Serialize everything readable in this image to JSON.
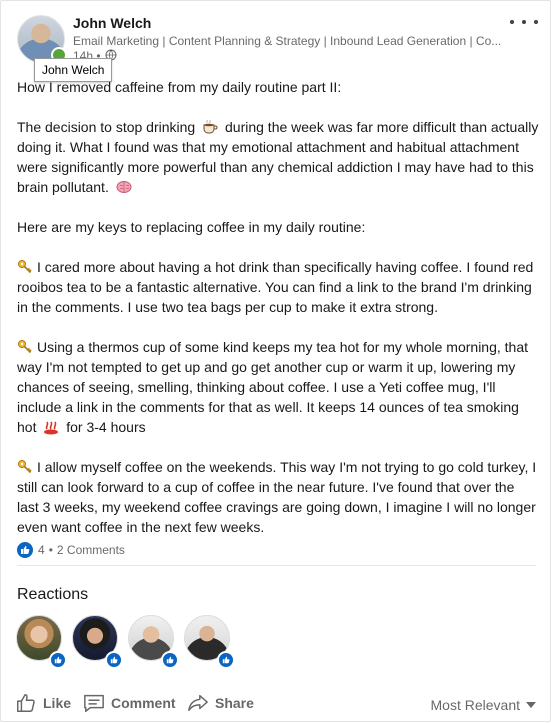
{
  "post": {
    "author_name": "John Welch",
    "author_headline": "Email Marketing | Content Planning & Strategy | Inbound Lead Generation | Co...",
    "timestamp": "14h •",
    "tooltip": "John Welch",
    "paragraphs": {
      "p1": "How I removed caffeine from my daily routine part II:",
      "p2a": "The decision to stop drinking",
      "p2b": "during the week was far more difficult than actually doing it. What I found was that my emotional attachment and habitual attachment were significantly more powerful than any chemical addiction I may have had to this brain pollutant.",
      "p3": "Here are my keys to replacing coffee in my daily routine:",
      "p4": "I cared more about having a hot drink than specifically having coffee. I found red rooibos tea to be a fantastic alternative. You can find a link to the brand I'm drinking in the comments. I use two tea bags per cup to make it extra strong.",
      "p5a": "Using a thermos cup of some kind keeps my tea hot for my whole morning, that way I'm not tempted to get up and go get another cup or warm it up, lowering my chances of seeing, smelling, thinking about coffee. I use a Yeti coffee mug, I'll include a link in the comments for that as well. It keeps 14 ounces of tea smoking hot",
      "p5b": "for 3-4 hours",
      "p6": "I allow myself coffee on the weekends. This way I'm not trying to go cold turkey, I still can look forward to a cup of coffee in the near future. I've found that over the last 3 weeks, my weekend coffee cravings are going down, I imagine I will no longer even want coffee in the next few weeks."
    }
  },
  "social": {
    "reaction_count": "4",
    "separator": "•",
    "comments": "2 Comments"
  },
  "reactions": {
    "title": "Reactions"
  },
  "actions": {
    "like": "Like",
    "comment": "Comment",
    "share": "Share",
    "sort": "Most Relevant"
  },
  "icons": {
    "more": "more-icon",
    "globe": "globe-icon",
    "key": "key-emoji",
    "coffee": "coffee-emoji",
    "brain": "brain-emoji",
    "hot": "hot-springs-emoji",
    "like_badge": "thumbs-up-icon"
  },
  "colors": {
    "accent": "#0a66c2",
    "online": "#57a639"
  }
}
